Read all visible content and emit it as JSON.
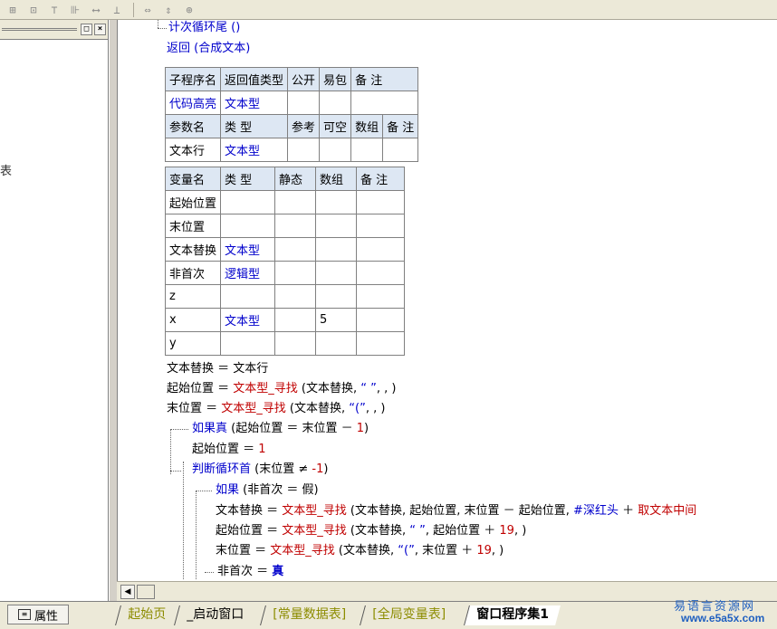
{
  "toolbar": {
    "icons": [
      "align-left-icon",
      "align-center-icon",
      "align-top-icon",
      "align-middle-icon",
      "space-horizontal-icon",
      "space-vertical-icon",
      "same-width-icon",
      "same-height-icon",
      "same-size-icon"
    ]
  },
  "left_panel": {
    "partial_char": "表",
    "btn_restore": "□",
    "btn_close": "×"
  },
  "code_top": {
    "line1": "计次循环尾 ()",
    "line2": "返回 (合成文本)"
  },
  "subprog_table": {
    "header": [
      "子程序名",
      "返回值类型",
      "公开",
      "易包",
      "备 注"
    ],
    "row": [
      "代码高亮",
      "文本型",
      "",
      "",
      ""
    ],
    "param_header": [
      "参数名",
      "类 型",
      "参考",
      "可空",
      "数组",
      "备 注"
    ],
    "param_row": [
      "文本行",
      "文本型",
      "",
      "",
      "",
      ""
    ]
  },
  "var_table": {
    "header": [
      "变量名",
      "类 型",
      "静态",
      "数组",
      "备 注"
    ],
    "rows": [
      [
        "起始位置",
        "",
        "",
        "",
        ""
      ],
      [
        "末位置",
        "",
        "",
        "",
        ""
      ],
      [
        "文本替换",
        "文本型",
        "",
        "",
        ""
      ],
      [
        "非首次",
        "逻辑型",
        "",
        "",
        ""
      ],
      [
        "z",
        "",
        "",
        "",
        ""
      ],
      [
        "x",
        "文本型",
        "",
        "5",
        ""
      ],
      [
        "y",
        "",
        "",
        "",
        ""
      ]
    ]
  },
  "code": {
    "l1": {
      "a": "文本替换 ＝ 文本行"
    },
    "l2": {
      "a": "起始位置 ＝ ",
      "b": "文本型_寻找",
      "c": " (文本替换, ",
      "d": "“ ”",
      "e": ", , )"
    },
    "l3": {
      "a": "末位置 ＝ ",
      "b": "文本型_寻找",
      "c": " (文本替换, ",
      "d": "“(”",
      "e": ", , )"
    },
    "l4": {
      "a": "如果真",
      "b": " (起始位置 ＝ 末位置 － ",
      "c": "1",
      "d": ")"
    },
    "l5": {
      "a": "起始位置 ＝ ",
      "b": "1"
    },
    "l6": {
      "a": "判断循环首",
      "b": " (末位置 ≠ ",
      "c": "-1",
      "d": ")"
    },
    "l7": {
      "a": "如果",
      "b": " (非首次 ＝ 假)"
    },
    "l8": {
      "a": "文本替换 ＝ ",
      "b": "文本型_寻找",
      "c": " (文本替换, 起始位置, 末位置 － 起始位置, ",
      "d": "#深红头",
      "e": " ＋ ",
      "f": "取文本中间"
    },
    "l9": {
      "a": "起始位置 ＝ ",
      "b": "文本型_寻找",
      "c": " (文本替换, ",
      "d": "“ ”",
      "e": ", 起始位置 ＋ ",
      "f": "19",
      "g": ", )"
    },
    "l10": {
      "a": "末位置 ＝ ",
      "b": "文本型_寻找",
      "c": " (文本替换, ",
      "d": "“(”",
      "e": ", 末位置 ＋ ",
      "f": "19",
      "g": ", )"
    },
    "l11": {
      "a": "非首次 ＝ ",
      "b": "真"
    }
  },
  "bottom": {
    "prop_label": "属性",
    "tabs": [
      "起始页",
      "_启动窗口",
      "[常量数据表]",
      "[全局变量表]",
      "窗口程序集1"
    ],
    "watermark1": "易语言资源网",
    "watermark2": "www.e5a5x.com"
  },
  "colors": {
    "keyword": "#0000cc",
    "function": "#c00000",
    "header_bg": "#dde7f3",
    "chrome": "#ece9d8"
  }
}
